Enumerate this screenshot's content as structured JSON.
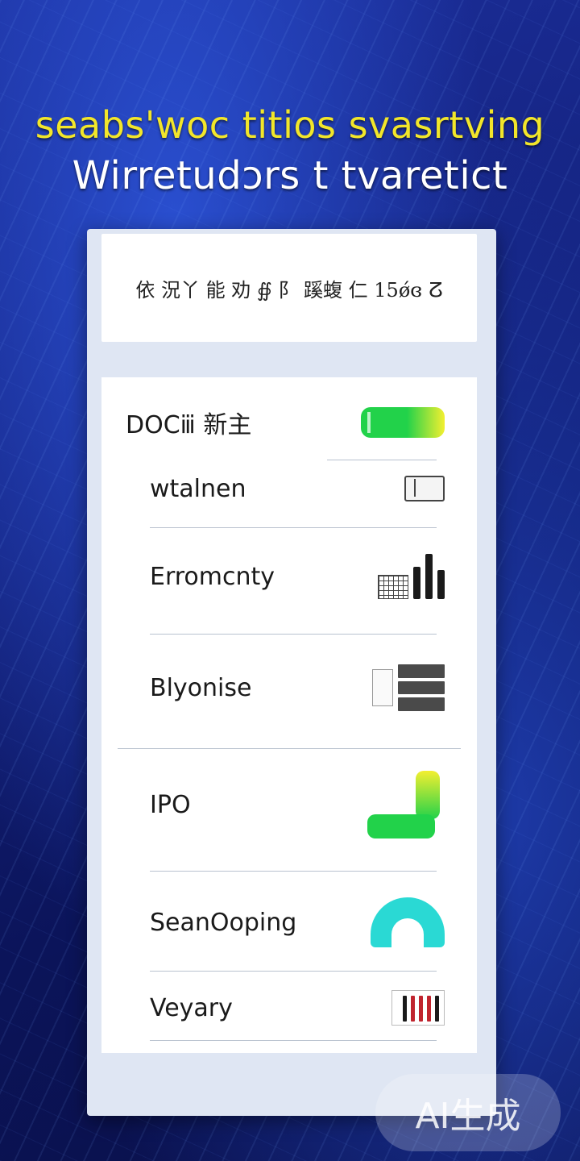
{
  "header": {
    "line1": "seabs'woc titios svasrtving",
    "line2": "Wirretudɔrs t tvaretict"
  },
  "search": {
    "text": "依 況丫 能 劝 ∯ 阝 蹊蝮 仁 15ǿɞ ⵒ"
  },
  "list": {
    "items": [
      {
        "label": "DOCⅲ 新主",
        "icon": "toggle-pill-icon"
      },
      {
        "label": "wtalnen",
        "icon": "document-card-icon"
      },
      {
        "label": "Erromcnty",
        "icon": "grid-bar-chart-icon"
      },
      {
        "label": "Blyonise",
        "icon": "table-sheet-icon"
      },
      {
        "label": "IPO",
        "icon": "pipe-icon"
      },
      {
        "label": "SeanOoping",
        "icon": "dome-icon"
      },
      {
        "label": "Veyary",
        "icon": "bars-icon"
      }
    ]
  },
  "colors": {
    "accent_yellow": "#f2e62a",
    "toggle_green": "#22d24a",
    "dome_cyan": "#2ad9d4",
    "bar_red": "#c0242e"
  },
  "watermark": {
    "text": "AI生成"
  }
}
